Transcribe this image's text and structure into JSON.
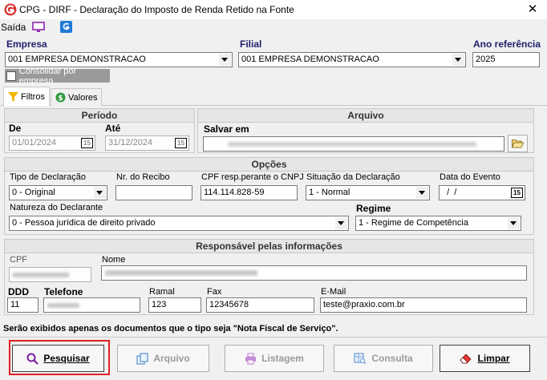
{
  "window": {
    "title": "CPG - DIRF - Declaração do Imposto de Renda Retido na Fonte",
    "close_label": "✕"
  },
  "menu": {
    "saida": "Saída"
  },
  "top": {
    "empresa_label": "Empresa",
    "empresa_value": "001 EMPRESA DEMONSTRACAO",
    "filial_label": "Filial",
    "filial_value": "001 EMPRESA DEMONSTRACAO",
    "ano_label": "Ano referência",
    "ano_value": "2025",
    "consolidar_label": "Consolidar por empresa"
  },
  "tabs": [
    {
      "label": "Filtros"
    },
    {
      "label": "Valores"
    }
  ],
  "periodo": {
    "header": "Período",
    "de_label": "De",
    "de_value": "01/01/2024",
    "ate_label": "Até",
    "ate_value": "31/12/2024",
    "cal_label": "15"
  },
  "arquivo": {
    "header": "Arquivo",
    "salvar_label": "Salvar em"
  },
  "opcoes": {
    "header": "Opções",
    "tipo_label": "Tipo de Declaração",
    "tipo_value": "0 - Original",
    "recibo_label": "Nr. do Recibo",
    "cpf_label": "CPF resp.perante o CNPJ",
    "cpf_value": "114.114.828-59",
    "situacao_label": "Situação da Declaração",
    "situacao_value": "1 - Normal",
    "data_evento_label": "Data do Evento",
    "data_evento_value": "  /  /",
    "natureza_label": "Natureza do Declarante",
    "natureza_value": "0 - Pessoa jurídica de direito privado",
    "regime_label": "Regime",
    "regime_value": "1 - Regime de Competência"
  },
  "responsavel": {
    "header": "Responsável pelas informações",
    "cpf_label": "CPF",
    "nome_label": "Nome",
    "ddd_label": "DDD",
    "ddd_value": "11",
    "telefone_label": "Telefone",
    "ramal_label": "Ramal",
    "ramal_value": "123",
    "fax_label": "Fax",
    "fax_value": "12345678",
    "email_label": "E-Mail",
    "email_value": "teste@praxio.com.br"
  },
  "info_message": "Serão exibidos apenas os documentos que o tipo seja \"Nota Fiscal de Serviço\".",
  "buttons": {
    "pesquisar": "Pesquisar",
    "arquivo": "Arquivo",
    "listagem": "Listagem",
    "consulta": "Consulta",
    "limpar": "Limpar"
  },
  "colors": {
    "accent_label": "#1f1f6b",
    "focus_red": "#e02020",
    "app_red": "#d9302c"
  }
}
